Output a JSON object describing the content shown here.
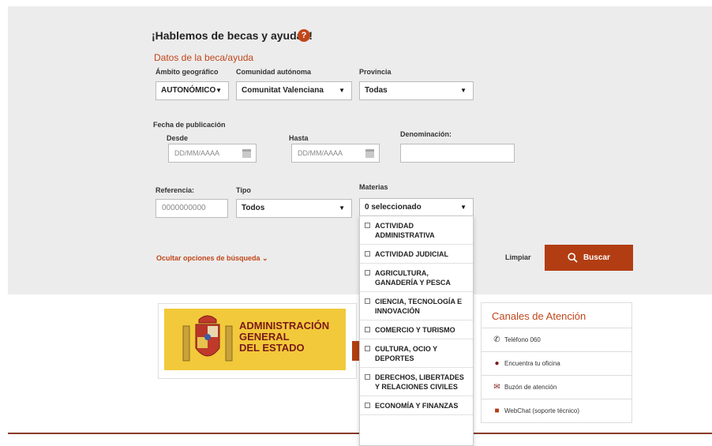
{
  "form": {
    "title": "¡Hablemos de becas y ayudas!",
    "help_icon": "?",
    "section_title": "Datos de la beca/ayuda",
    "ambito": {
      "label": "Ámbito geográfico",
      "value": "AUTONÓMICO"
    },
    "comunidad": {
      "label": "Comunidad autónoma",
      "value": "Comunitat Valenciana"
    },
    "provincia": {
      "label": "Provincia",
      "value": "Todas"
    },
    "fecha": {
      "label": "Fecha de publicación",
      "desde_label": "Desde",
      "desde_placeholder": "DD/MM/AAAA",
      "hasta_label": "Hasta",
      "hasta_placeholder": "DD/MM/AAAA"
    },
    "denominacion": {
      "label": "Denominación:",
      "value": ""
    },
    "referencia": {
      "label": "Referencia:",
      "placeholder": "0000000000"
    },
    "tipo": {
      "label": "Tipo",
      "value": "Todos"
    },
    "materias": {
      "label": "Materias",
      "value": "0 seleccionado",
      "options": [
        "ACTIVIDAD ADMINISTRATIVA",
        "ACTIVIDAD JUDICIAL",
        "AGRICULTURA, GANADERÍA Y PESCA",
        "CIENCIA, TECNOLOGÍA E INNOVACIÓN",
        "COMERCIO Y TURISMO",
        "CULTURA, OCIO Y DEPORTES",
        "DERECHOS, LIBERTADES Y RELACIONES CIVILES",
        "ECONOMÍA Y FINANZAS"
      ]
    },
    "hide_options": "Ocultar opciones de búsqueda",
    "clear": "Limpiar",
    "search": "Buscar"
  },
  "logo": {
    "line1": "ADMINISTRACIÓN",
    "line2": "GENERAL",
    "line3": "DEL ESTADO"
  },
  "channels": {
    "title": "Canales de Atención",
    "items": [
      {
        "label": "Teléfono 060",
        "icon": "phone-icon"
      },
      {
        "label": "Encuentra tu oficina",
        "icon": "location-pin-icon"
      },
      {
        "label": "Buzón de atención",
        "icon": "mail-icon"
      },
      {
        "label": "WebChat (soporte técnico)",
        "icon": "chat-icon"
      }
    ]
  },
  "colors": {
    "accent": "#c0461a",
    "button": "#b23d12",
    "panel_bg": "#ececec",
    "logo_yellow": "#f2c93a"
  }
}
